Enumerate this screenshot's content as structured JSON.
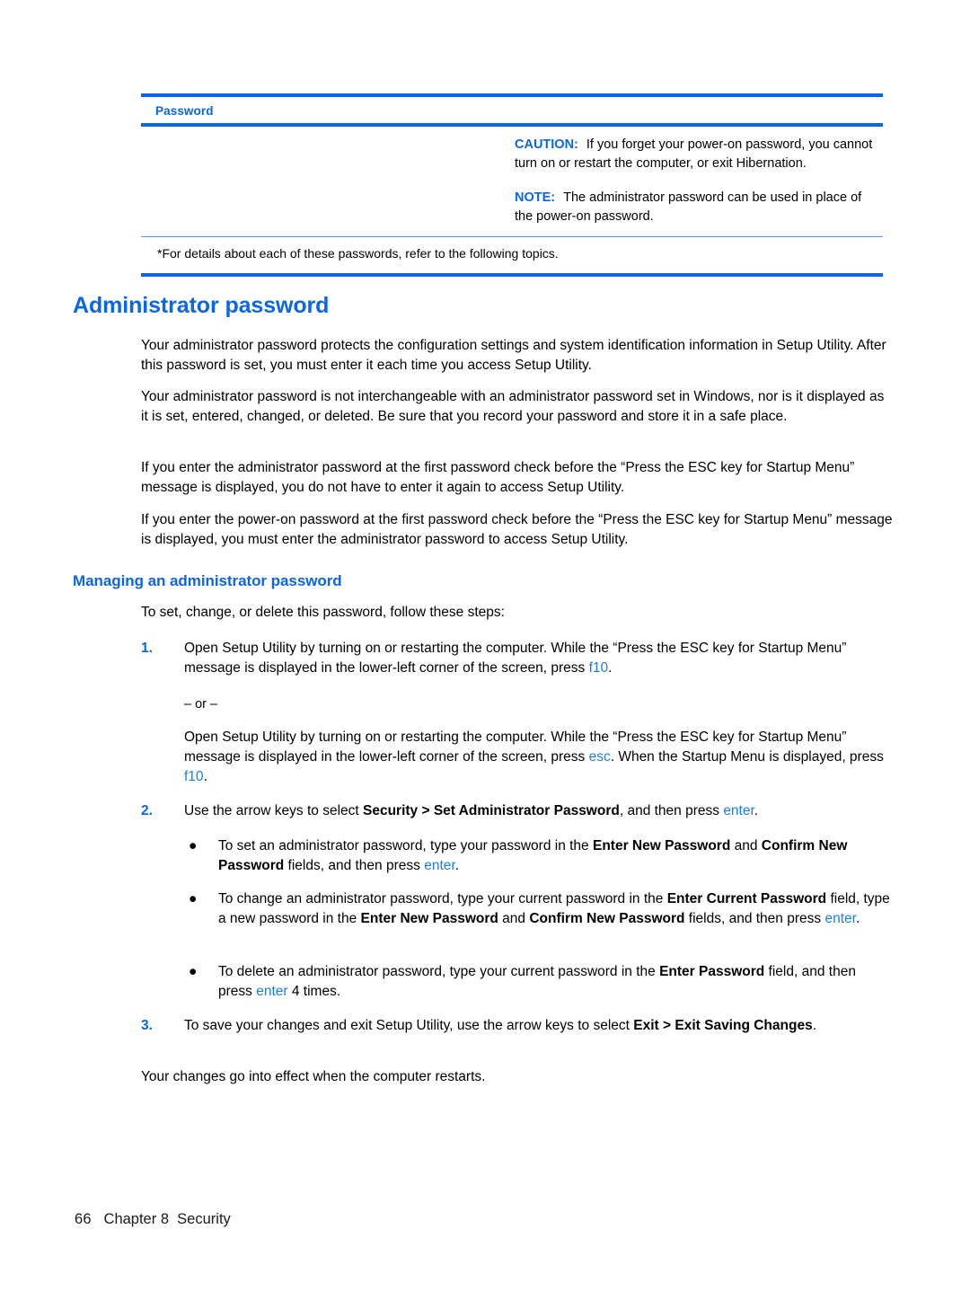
{
  "table": {
    "header": "Password",
    "admonitions": [
      {
        "label": "CAUTION:",
        "text": "If you forget your power-on password, you cannot turn on or restart the computer, or exit Hibernation."
      },
      {
        "label": "NOTE:",
        "text": "The administrator password can be used in place of the power-on password."
      }
    ],
    "footnote": "*For details about each of these passwords, refer to the following topics."
  },
  "headings": {
    "h1": "Administrator password",
    "h2": "Managing an administrator password"
  },
  "paragraphs": {
    "p1": "Your administrator password protects the configuration settings and system identification information in Setup Utility. After this password is set, you must enter it each time you access Setup Utility.",
    "p2": "Your administrator password is not interchangeable with an administrator password set in Windows, nor is it displayed as it is set, entered, changed, or deleted. Be sure that you record your password and store it in a safe place.",
    "p3": "If you enter the administrator password at the first password check before the “Press the ESC key for Startup Menu” message is displayed, you do not have to enter it again to access Setup Utility.",
    "p4": "If you enter the power-on password at the first password check before the “Press the ESC key for Startup Menu” message is displayed, you must enter the administrator password to access Setup Utility.",
    "intro": "To set, change, or delete this password, follow these steps:",
    "closing": "Your changes go into effect when the computer restarts."
  },
  "steps": {
    "step1": {
      "num": "1.",
      "text_a": "Open Setup Utility by turning on or restarting the computer. While the “Press the ESC key for Startup Menu” message is displayed in the lower-left corner of the screen, press ",
      "key_a": "f10",
      "text_b": ".",
      "or": "– or –",
      "alt_a": "Open Setup Utility by turning on or restarting the computer. While the “Press the ESC key for Startup Menu” message is displayed in the lower-left corner of the screen, press ",
      "alt_key1": "esc",
      "alt_b": ". When the Startup Menu is displayed, press ",
      "alt_key2": "f10",
      "alt_c": "."
    },
    "step2": {
      "num": "2.",
      "text_a": "Use the arrow keys to select ",
      "bold_a": "Security > Set Administrator Password",
      "text_b": ", and then press ",
      "key_a": "enter",
      "text_c": "."
    },
    "step3": {
      "num": "3.",
      "text_a": "To save your changes and exit Setup Utility, use the arrow keys to select ",
      "bold_a": "Exit > Exit Saving Changes",
      "text_b": "."
    }
  },
  "bullets": {
    "bullet_glyph": "●",
    "b1": {
      "text_a": "To set an administrator password, type your password in the ",
      "bold_a": "Enter New Password",
      "text_b": " and ",
      "bold_b": "Confirm New Password",
      "text_c": " fields, and then press ",
      "key_a": "enter",
      "text_d": "."
    },
    "b2": {
      "text_a": "To change an administrator password, type your current password in the ",
      "bold_a": "Enter Current Password",
      "text_b": " field, type a new password in the ",
      "bold_b": "Enter New Password",
      "text_c": " and ",
      "bold_c": "Confirm New Password",
      "text_d": " fields, and then press ",
      "key_a": "enter",
      "text_e": "."
    },
    "b3": {
      "text_a": "To delete an administrator password, type your current password in the ",
      "bold_a": "Enter Password",
      "text_b": " field, and then press ",
      "key_a": "enter",
      "text_c": " 4 times."
    }
  },
  "footer": {
    "page_number": "66",
    "chapter": "Chapter 8",
    "section": "Security"
  },
  "colors": {
    "accent_blue": "#0A66E6",
    "key_blue": "#1A7DEA",
    "rule_thin": "#4D93F0"
  }
}
